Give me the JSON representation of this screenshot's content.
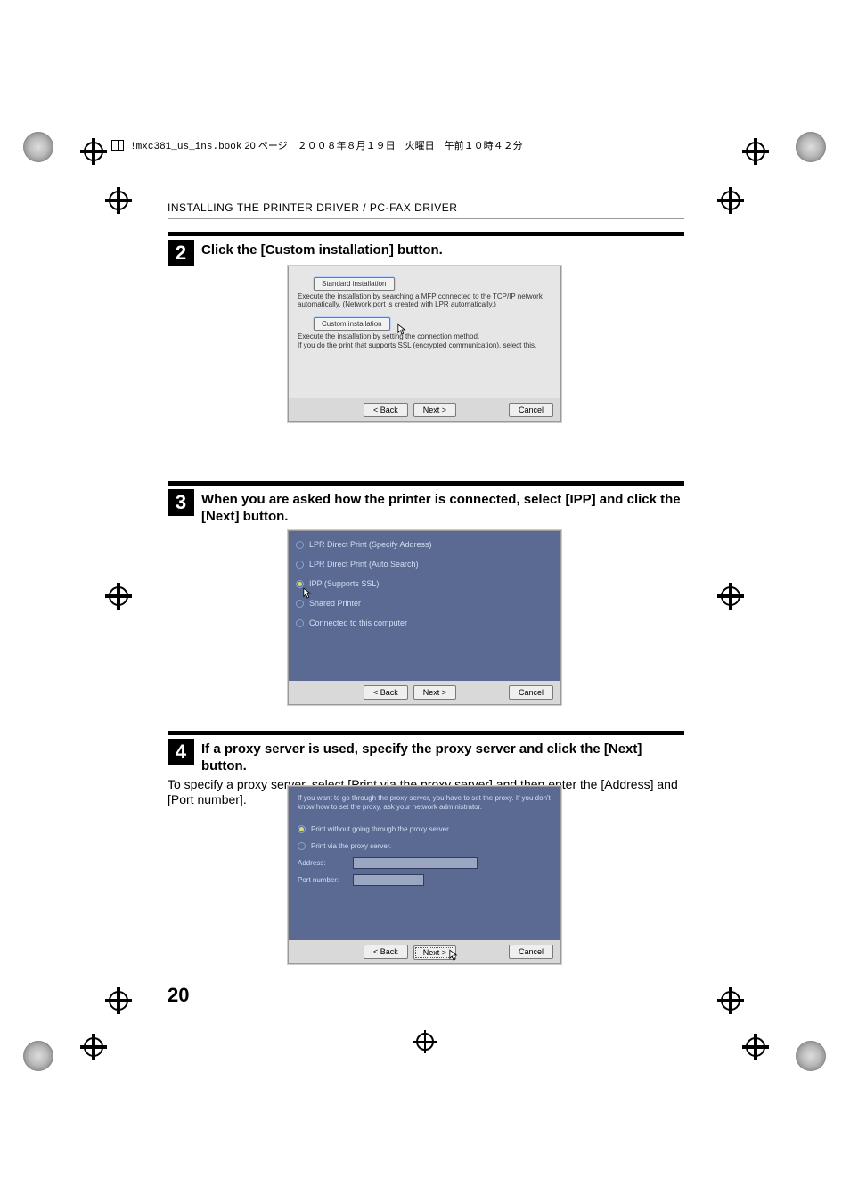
{
  "book_header": {
    "filename": "!mxc381_us_ins.book",
    "pageinfo": "20 ページ　２００８年８月１９日　火曜日　午前１０時４２分"
  },
  "section_title": "INSTALLING THE PRINTER DRIVER / PC-FAX DRIVER",
  "steps": {
    "s2": {
      "num": "2",
      "title": "Click the [Custom installation] button."
    },
    "s3": {
      "num": "3",
      "title": "When you are asked how the printer is connected, select [IPP] and click the [Next] button."
    },
    "s4": {
      "num": "4",
      "title": "If a proxy server is used, specify the proxy server and click the [Next] button.",
      "body": "To specify a proxy server, select [Print via the proxy server] and then enter the [Address] and [Port number]."
    }
  },
  "dlg1": {
    "standard_btn": "Standard installation",
    "standard_desc": "Execute the installation by searching a MFP connected to the TCP/IP network automatically. (Network port is created with LPR automatically.)",
    "custom_btn": "Custom installation",
    "custom_desc": "Execute the installation by setting the connection method.\nIf you do the print that supports SSL (encrypted communication), select this."
  },
  "dlg2": {
    "opt1": "LPR Direct Print (Specify Address)",
    "opt2": "LPR Direct Print (Auto Search)",
    "opt3": "IPP (Supports SSL)",
    "opt4": "Shared Printer",
    "opt5": "Connected to this computer"
  },
  "dlg3": {
    "intro": "If you want to go through the proxy server, you have to set the proxy. If you don't know how to set the proxy, ask your network administrator.",
    "opt_noproxy": "Print without going through the proxy server.",
    "opt_proxy": "Print via the proxy server.",
    "addr_label": "Address:",
    "port_label": "Port number:"
  },
  "buttons": {
    "back": "< Back",
    "next": "Next >",
    "cancel": "Cancel"
  },
  "page_number": "20"
}
